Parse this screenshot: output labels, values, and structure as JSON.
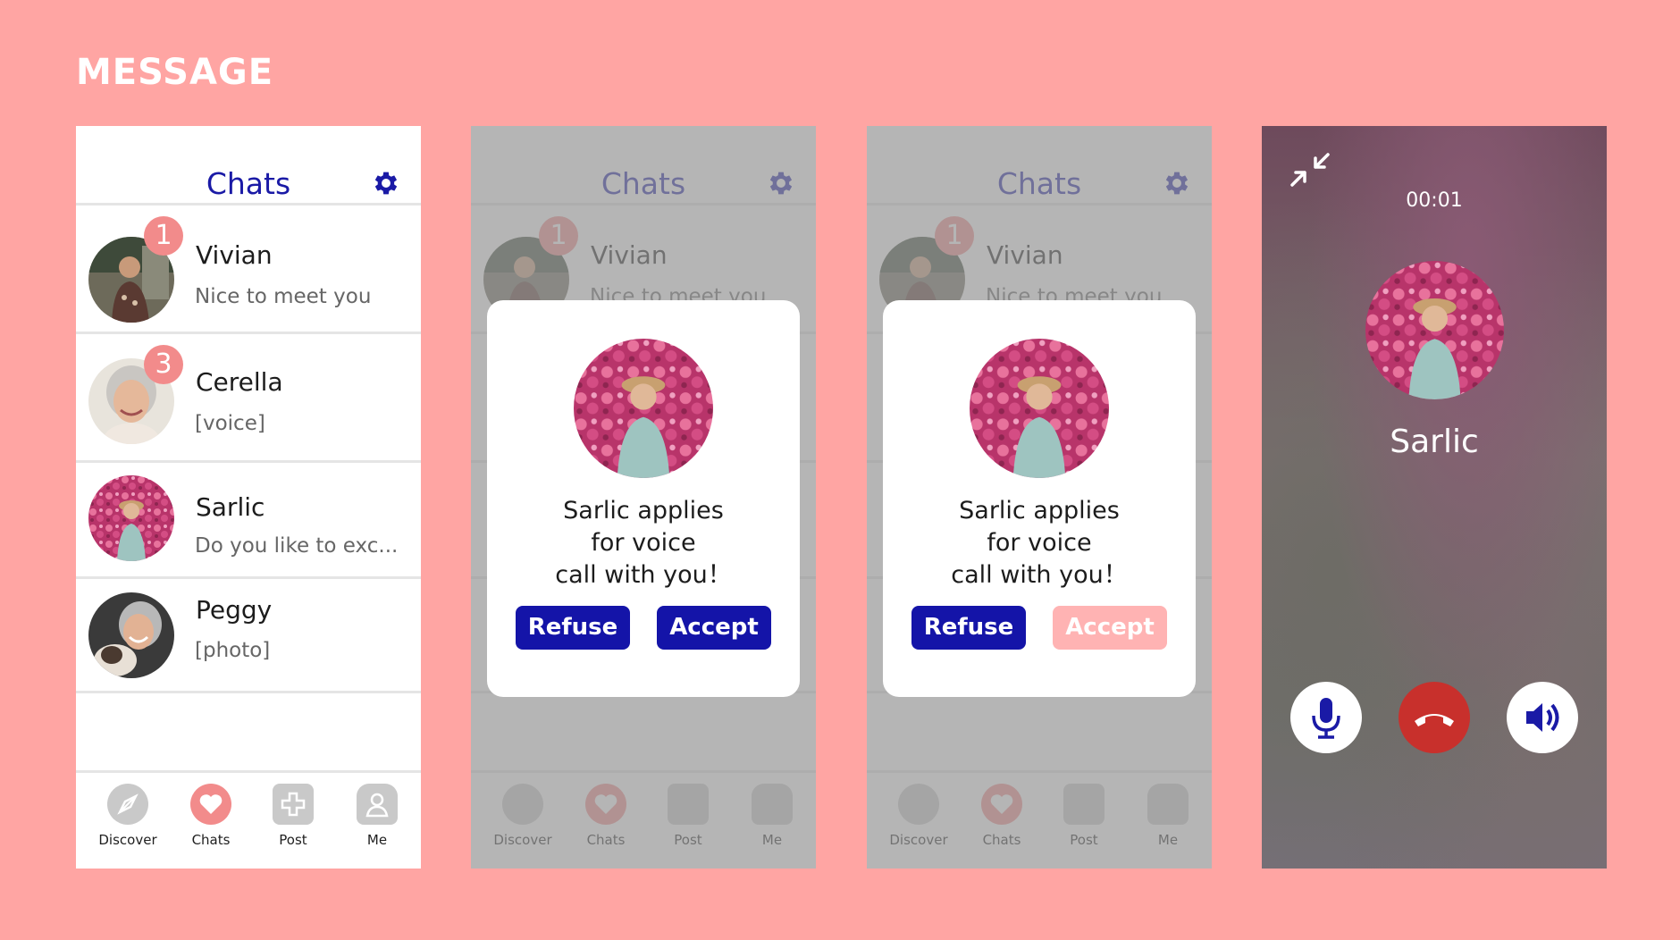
{
  "page_title": "MESSAGE",
  "colors": {
    "background": "#ffa5a3",
    "accent_blue": "#1a1aa6",
    "badge_pink": "#f28b8b",
    "accept_pressed": "#ffb3b3",
    "end_call_red": "#c8302c"
  },
  "chats_screen": {
    "title": "Chats",
    "settings_icon": "gear-icon",
    "chats": [
      {
        "name": "Vivian",
        "message": "Nice to meet you",
        "badge": "1"
      },
      {
        "name": "Cerella",
        "message": "[voice]",
        "badge": "3"
      },
      {
        "name": "Sarlic",
        "message": "Do you like to exc...",
        "badge": ""
      },
      {
        "name": "Peggy",
        "message": "[photo]",
        "badge": ""
      }
    ],
    "tabs": [
      {
        "label": "Discover",
        "icon": "compass-icon"
      },
      {
        "label": "Chats",
        "icon": "heart-chat-icon"
      },
      {
        "label": "Post",
        "icon": "plus-icon"
      },
      {
        "label": "Me",
        "icon": "person-icon"
      }
    ],
    "active_tab": "Chats"
  },
  "call_request_modal": {
    "line1": "Sarlic applies",
    "line2": "for voice",
    "line3": "call with you！",
    "refuse_label": "Refuse",
    "accept_label": "Accept"
  },
  "call_screen": {
    "timer": "00:01",
    "caller_name": "Sarlic",
    "minimize_icon": "minimize-icon",
    "buttons": [
      "microphone-icon",
      "end-call-icon",
      "speaker-icon"
    ]
  }
}
